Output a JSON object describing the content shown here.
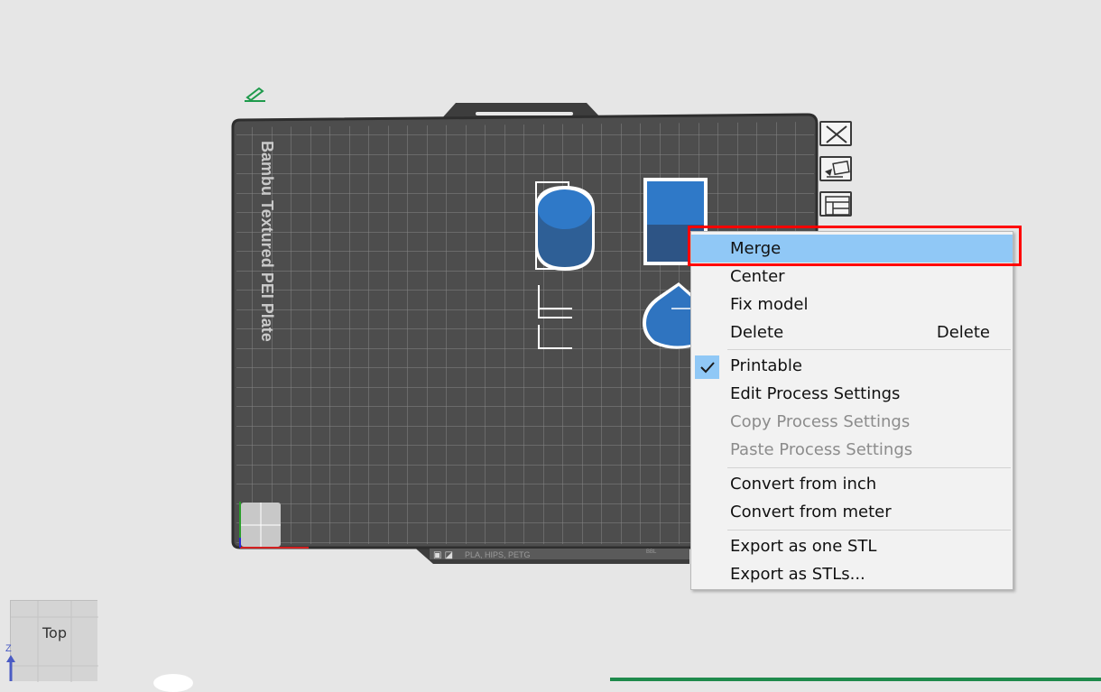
{
  "plate": {
    "label": "Bambu Textured PEI Plate",
    "bottom_strip_text": "PLA, HIPS, PETG",
    "bottom_strip_right_text": "BBL"
  },
  "context_menu": {
    "items": [
      {
        "label": "Merge",
        "shortcut": "",
        "highlighted": true
      },
      {
        "label": "Center",
        "shortcut": ""
      },
      {
        "label": "Fix model",
        "shortcut": ""
      },
      {
        "label": "Delete",
        "shortcut": "Delete"
      },
      {
        "label": "Printable",
        "shortcut": "",
        "checked": true
      },
      {
        "label": "Edit Process Settings",
        "shortcut": ""
      },
      {
        "label": "Copy Process Settings",
        "shortcut": "",
        "disabled": true
      },
      {
        "label": "Paste Process Settings",
        "shortcut": "",
        "disabled": true
      },
      {
        "label": "Convert from inch",
        "shortcut": ""
      },
      {
        "label": "Convert from meter",
        "shortcut": ""
      },
      {
        "label": "Export as one STL",
        "shortcut": ""
      },
      {
        "label": "Export as STLs...",
        "shortcut": ""
      }
    ]
  },
  "view_cube": {
    "face_label": "Top",
    "axis_label": "Z"
  },
  "colors": {
    "plate": "#4a4a4a",
    "grid_line": "#8a8a8a",
    "model_blue": "#2f74c0",
    "selection_highlight": "#90c8f6",
    "annotation_red": "#ff0000",
    "accent_green": "#1f8a4c"
  }
}
